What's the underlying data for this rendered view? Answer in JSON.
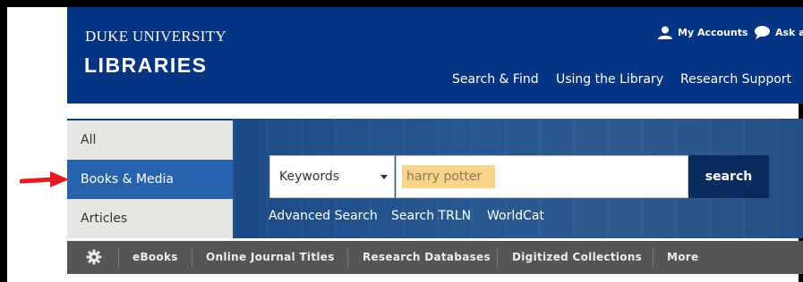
{
  "header": {
    "logo_line1": "DUKE UNIVERSITY",
    "logo_line2": "LIBRARIES",
    "utility": {
      "accounts_label": "My Accounts",
      "ask_label": "Ask a"
    },
    "nav": [
      "Search & Find",
      "Using the Library",
      "Research Support"
    ]
  },
  "search": {
    "tabs": [
      "All",
      "Books & Media",
      "Articles"
    ],
    "active_tab": "Books & Media",
    "field_select": "Keywords",
    "query_value": "harry potter",
    "button_label": "search",
    "links": [
      "Advanced Search",
      "Search TRLN",
      "WorldCat"
    ]
  },
  "quicklinks": {
    "icon": "gear-icon",
    "items": [
      "eBooks",
      "Online Journal Titles",
      "Research Databases",
      "Digitized Collections",
      "More"
    ]
  },
  "annotation": {
    "arrow_color": "#e31b23"
  },
  "colors": {
    "header_bg": "#053482",
    "active_tab": "#2762ac",
    "search_button": "#0a2c5c",
    "highlight": "#f8d38a",
    "quickbar": "#555555"
  }
}
